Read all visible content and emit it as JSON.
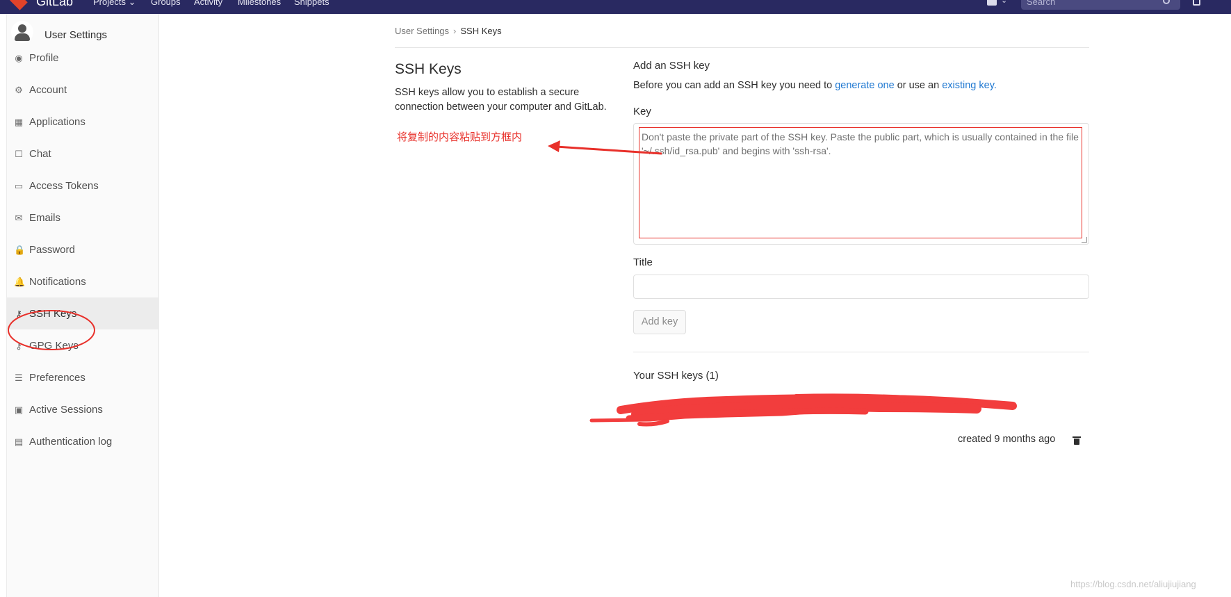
{
  "navbar": {
    "brand": "GitLab",
    "links": [
      "Projects",
      "Groups",
      "Activity",
      "Milestones",
      "Snippets"
    ],
    "projects_caret": "⌄",
    "search_placeholder": "Search"
  },
  "sidebar": {
    "title": "User Settings",
    "items": [
      {
        "label": "Profile",
        "icon": "profile-icon",
        "glyph": "◉"
      },
      {
        "label": "Account",
        "icon": "account-icon",
        "glyph": "⚙"
      },
      {
        "label": "Applications",
        "icon": "applications-icon",
        "glyph": "▦"
      },
      {
        "label": "Chat",
        "icon": "chat-icon",
        "glyph": "☐"
      },
      {
        "label": "Access Tokens",
        "icon": "access-tokens-icon",
        "glyph": "▭"
      },
      {
        "label": "Emails",
        "icon": "emails-icon",
        "glyph": "✉"
      },
      {
        "label": "Password",
        "icon": "password-icon",
        "glyph": "🔒"
      },
      {
        "label": "Notifications",
        "icon": "notifications-icon",
        "glyph": "🔔"
      },
      {
        "label": "SSH Keys",
        "icon": "key-icon",
        "glyph": "⚷",
        "active": true
      },
      {
        "label": "GPG Keys",
        "icon": "gpg-key-icon",
        "glyph": "⚷"
      },
      {
        "label": "Preferences",
        "icon": "preferences-icon",
        "glyph": "☰"
      },
      {
        "label": "Active Sessions",
        "icon": "active-sessions-icon",
        "glyph": "▣"
      },
      {
        "label": "Authentication log",
        "icon": "authentication-log-icon",
        "glyph": "▤"
      }
    ]
  },
  "breadcrumb": {
    "parent": "User Settings",
    "separator": "›",
    "current": "SSH Keys"
  },
  "section": {
    "title": "SSH Keys",
    "description": "SSH keys allow you to establish a secure connection between your computer and GitLab."
  },
  "annotation": {
    "text": "将复制的内容粘贴到方框内",
    "color": "#e8302a"
  },
  "form": {
    "heading": "Add an SSH key",
    "intro_before": "Before you can add an SSH key you need to ",
    "generate_link": "generate one",
    "intro_middle": " or use an ",
    "existing_link": "existing key.",
    "key_label": "Key",
    "key_placeholder": "Don't paste the private part of the SSH key. Paste the public part, which is usually contained in the file '~/.ssh/id_rsa.pub' and begins with 'ssh-rsa'.",
    "title_label": "Title",
    "title_value": "",
    "add_button": "Add key"
  },
  "keys_list": {
    "heading": "Your SSH keys (1)",
    "created": "created 9 months ago"
  },
  "watermark": "https://blog.csdn.net/aliujiujiang",
  "colors": {
    "navbar": "#292961",
    "link": "#1f78d1",
    "annotation_red": "#e8302a"
  }
}
